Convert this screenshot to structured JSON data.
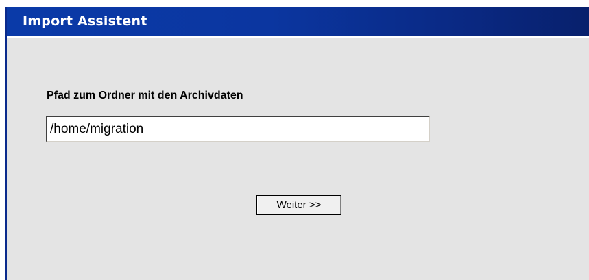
{
  "window": {
    "title": "Import Assistent"
  },
  "form": {
    "path_label": "Pfad zum Ordner mit den Archivdaten",
    "path_value": "/home/migration",
    "next_button_label": "Weiter >>"
  },
  "colors": {
    "titlebar": "#0a3aa8",
    "panel_background": "#e4e4e4",
    "title_text": "#ffffff"
  }
}
